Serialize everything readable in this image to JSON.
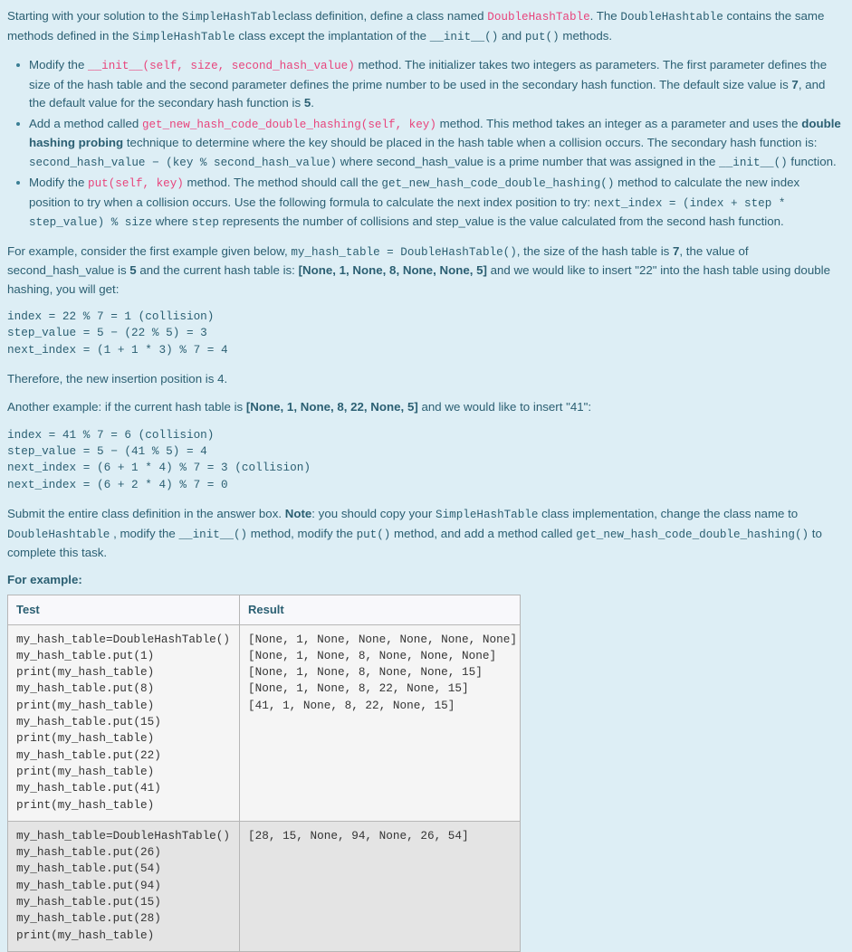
{
  "intro": {
    "p1_seg1": "Starting with your solution to the ",
    "p1_code1": "SimpleHashTable",
    "p1_seg2": "class definition, define a class named ",
    "p1_kw1": "DoubleHashTable",
    "p1_seg3": ". The ",
    "p1_code2": "DoubleHashtable",
    "p1_seg4": " contains the same methods defined in the ",
    "p1_code3": "SimpleHashTable",
    "p1_seg5": " class except the implantation of the ",
    "p1_code4": "__init__()",
    "p1_seg6": " and ",
    "p1_code5": "put()",
    "p1_seg7": " methods."
  },
  "bullets": [
    {
      "seg1": "Modify the ",
      "kw1": "__init__(self, size, second_hash_value)",
      "seg2": " method. The initializer takes two integers as parameters. The first parameter defines the size of the hash table and the second parameter defines the prime number to be used in the secondary hash function. The default size value is ",
      "bold1": "7",
      "seg3": ", and the default value for the secondary hash function is ",
      "bold2": "5",
      "seg4": "."
    },
    {
      "seg1": "Add a method called ",
      "kw1": "get_new_hash_code_double_hashing(self, key)",
      "seg2": " method. This method takes an integer as a parameter and uses the ",
      "bold1": "double hashing probing",
      "seg3": " technique to determine where the key should be placed in the hash table when a collision occurs. The secondary hash function is:  ",
      "code1": "second_hash_value − (key % second_hash_value)",
      "seg4": " where second_hash_value is a prime number that was assigned in the ",
      "code2": "__init__()",
      "seg5": " function."
    },
    {
      "seg1": "Modify the ",
      "kw1": "put(self, key)",
      "seg2": " method. The method should call the ",
      "code1": "get_new_hash_code_double_hashing()",
      "seg3": " method to calculate the new index position to try when a collision occurs. Use the following formula to calculate the next index position to try: ",
      "code2": "next_index  = (index + step * step_value) % size",
      "seg4": "  where ",
      "code3": "step",
      "seg5": " represents the number of collisions and step_value is the value calculated from the second hash function."
    }
  ],
  "example1": {
    "seg1": "For example, consider the first example given below, ",
    "code1": "my_hash_table = DoubleHashTable()",
    "seg2": ", the size of the hash table is ",
    "bold1": "7",
    "seg3": ", the value of second_hash_value is ",
    "bold2": "5",
    "seg4": " and the current hash table is:  ",
    "bold3": "[None, 1, None, 8, None, None, 5]",
    "seg5": " and we would like to insert \"22\" into the hash table using double hashing, you will get:",
    "code_block": "index = 22 % 7 = 1 (collision)\nstep_value = 5 − (22 % 5) = 3\nnext_index = (1 + 1 * 3) % 7 = 4",
    "conclusion": "Therefore, the new insertion position is 4."
  },
  "example2": {
    "seg1": "Another example: if the current hash table is ",
    "bold1": "[None, 1, None, 8, 22, None, 5]",
    "seg2": " and we would like to insert \"41\":",
    "code_block": "index = 41 % 7 = 6 (collision)\nstep_value = 5 − (41 % 5) = 4\nnext_index = (6 + 1 * 4) % 7 = 3 (collision)\nnext_index = (6 + 2 * 4) % 7 = 0"
  },
  "submit": {
    "seg1": "Submit the entire class definition in the answer box. ",
    "bold1": "Note",
    "seg2": ": you should copy your ",
    "code1": "SimpleHashTable",
    "seg3": " class implementation, change the class name to ",
    "code2": "DoubleHashtable",
    "seg4": " , modify the ",
    "code3": "__init__()",
    "seg5": " method, modify the ",
    "code4": "put()",
    "seg6": " method, and add a method called ",
    "code5": "get_new_hash_code_double_hashing()",
    "seg7": " to complete this task."
  },
  "for_example_label": "For example:",
  "table": {
    "headers": [
      "Test",
      "Result"
    ],
    "rows": [
      {
        "test": "my_hash_table=DoubleHashTable()\nmy_hash_table.put(1)\nprint(my_hash_table)\nmy_hash_table.put(8)\nprint(my_hash_table)\nmy_hash_table.put(15)\nprint(my_hash_table)\nmy_hash_table.put(22)\nprint(my_hash_table)\nmy_hash_table.put(41)\nprint(my_hash_table)",
        "result": "[None, 1, None, None, None, None, None]\n[None, 1, None, 8, None, None, None]\n[None, 1, None, 8, None, None, 15]\n[None, 1, None, 8, 22, None, 15]\n[41, 1, None, 8, 22, None, 15]"
      },
      {
        "test": "my_hash_table=DoubleHashTable()\nmy_hash_table.put(26)\nmy_hash_table.put(54)\nmy_hash_table.put(94)\nmy_hash_table.put(15)\nmy_hash_table.put(28)\nprint(my_hash_table)",
        "result": "[28, 15, None, 94, None, 26, 54]"
      }
    ]
  },
  "colors": {
    "background": "#ddeef5",
    "text": "#2b5f72",
    "keyword": "#e8447c",
    "table_border": "#b6b6b6",
    "row_odd_bg": "#f5f5f5",
    "row_even_bg": "#e4e4e4",
    "header_bg": "#f8f8fb"
  }
}
